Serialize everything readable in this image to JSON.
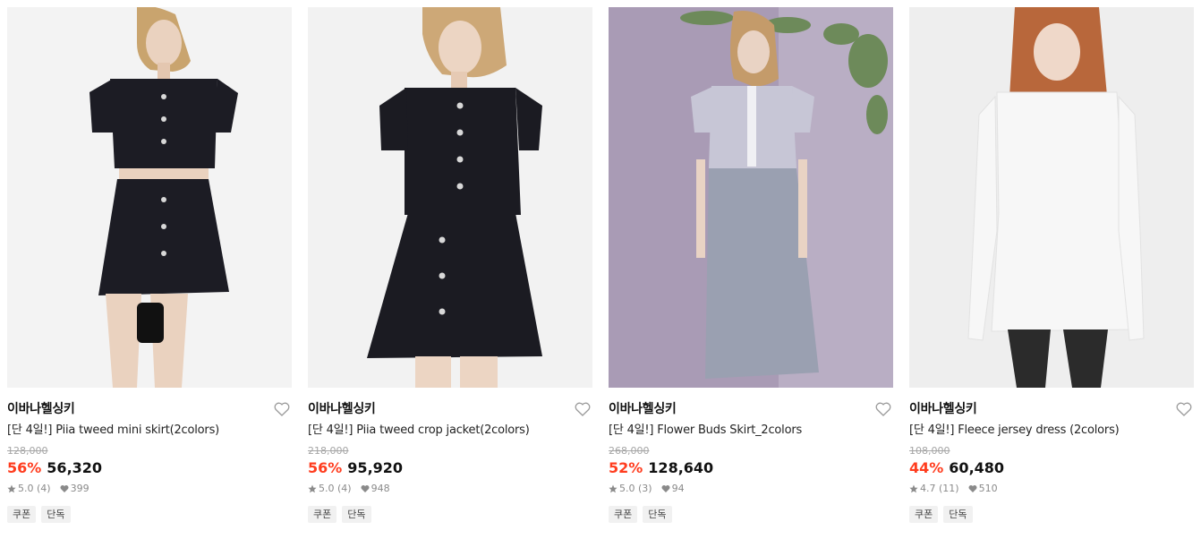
{
  "products": [
    {
      "brand": "이바나헬싱키",
      "title": "[단 4일!] Piia tweed mini skirt(2colors)",
      "original_price": "128,000",
      "discount": "56%",
      "price": "56,320",
      "rating": "5.0",
      "reviews": "(4)",
      "likes": "399",
      "tags": [
        "쿠폰",
        "단독"
      ],
      "image_subject": "model in black tweed crop jacket and mini skirt",
      "bg_color": "#f3f3f3",
      "outfit_color": "#1c1c24"
    },
    {
      "brand": "이바나헬싱키",
      "title": "[단 4일!] Piia tweed crop jacket(2colors)",
      "original_price": "218,000",
      "discount": "56%",
      "price": "95,920",
      "rating": "5.0",
      "reviews": "(4)",
      "likes": "948",
      "tags": [
        "쿠폰",
        "단독"
      ],
      "image_subject": "model in black tweed crop jacket and mini skirt",
      "bg_color": "#f2f2f2",
      "outfit_color": "#1b1b22"
    },
    {
      "brand": "이바나헬싱키",
      "title": "[단 4일!] Flower Buds Skirt_2colors",
      "original_price": "268,000",
      "discount": "52%",
      "price": "128,640",
      "rating": "5.0",
      "reviews": "(3)",
      "likes": "94",
      "tags": [
        "쿠폰",
        "단독"
      ],
      "image_subject": "model in grey lace dress with leaves",
      "bg_color": "#a99bb5",
      "outfit_color": "#9aa0b1"
    },
    {
      "brand": "이바나헬싱키",
      "title": "[단 4일!] Fleece jersey dress (2colors)",
      "original_price": "108,000",
      "discount": "44%",
      "price": "60,480",
      "rating": "4.7",
      "reviews": "(11)",
      "likes": "510",
      "tags": [
        "쿠폰",
        "단독"
      ],
      "image_subject": "model in white fleece long-sleeve dress",
      "bg_color": "#eeeeee",
      "outfit_color": "#f7f7f7"
    }
  ],
  "colors": {
    "discount": "#ff3d1f",
    "strikethrough": "#a6a6a6",
    "tag_bg": "#f1f1f1"
  }
}
